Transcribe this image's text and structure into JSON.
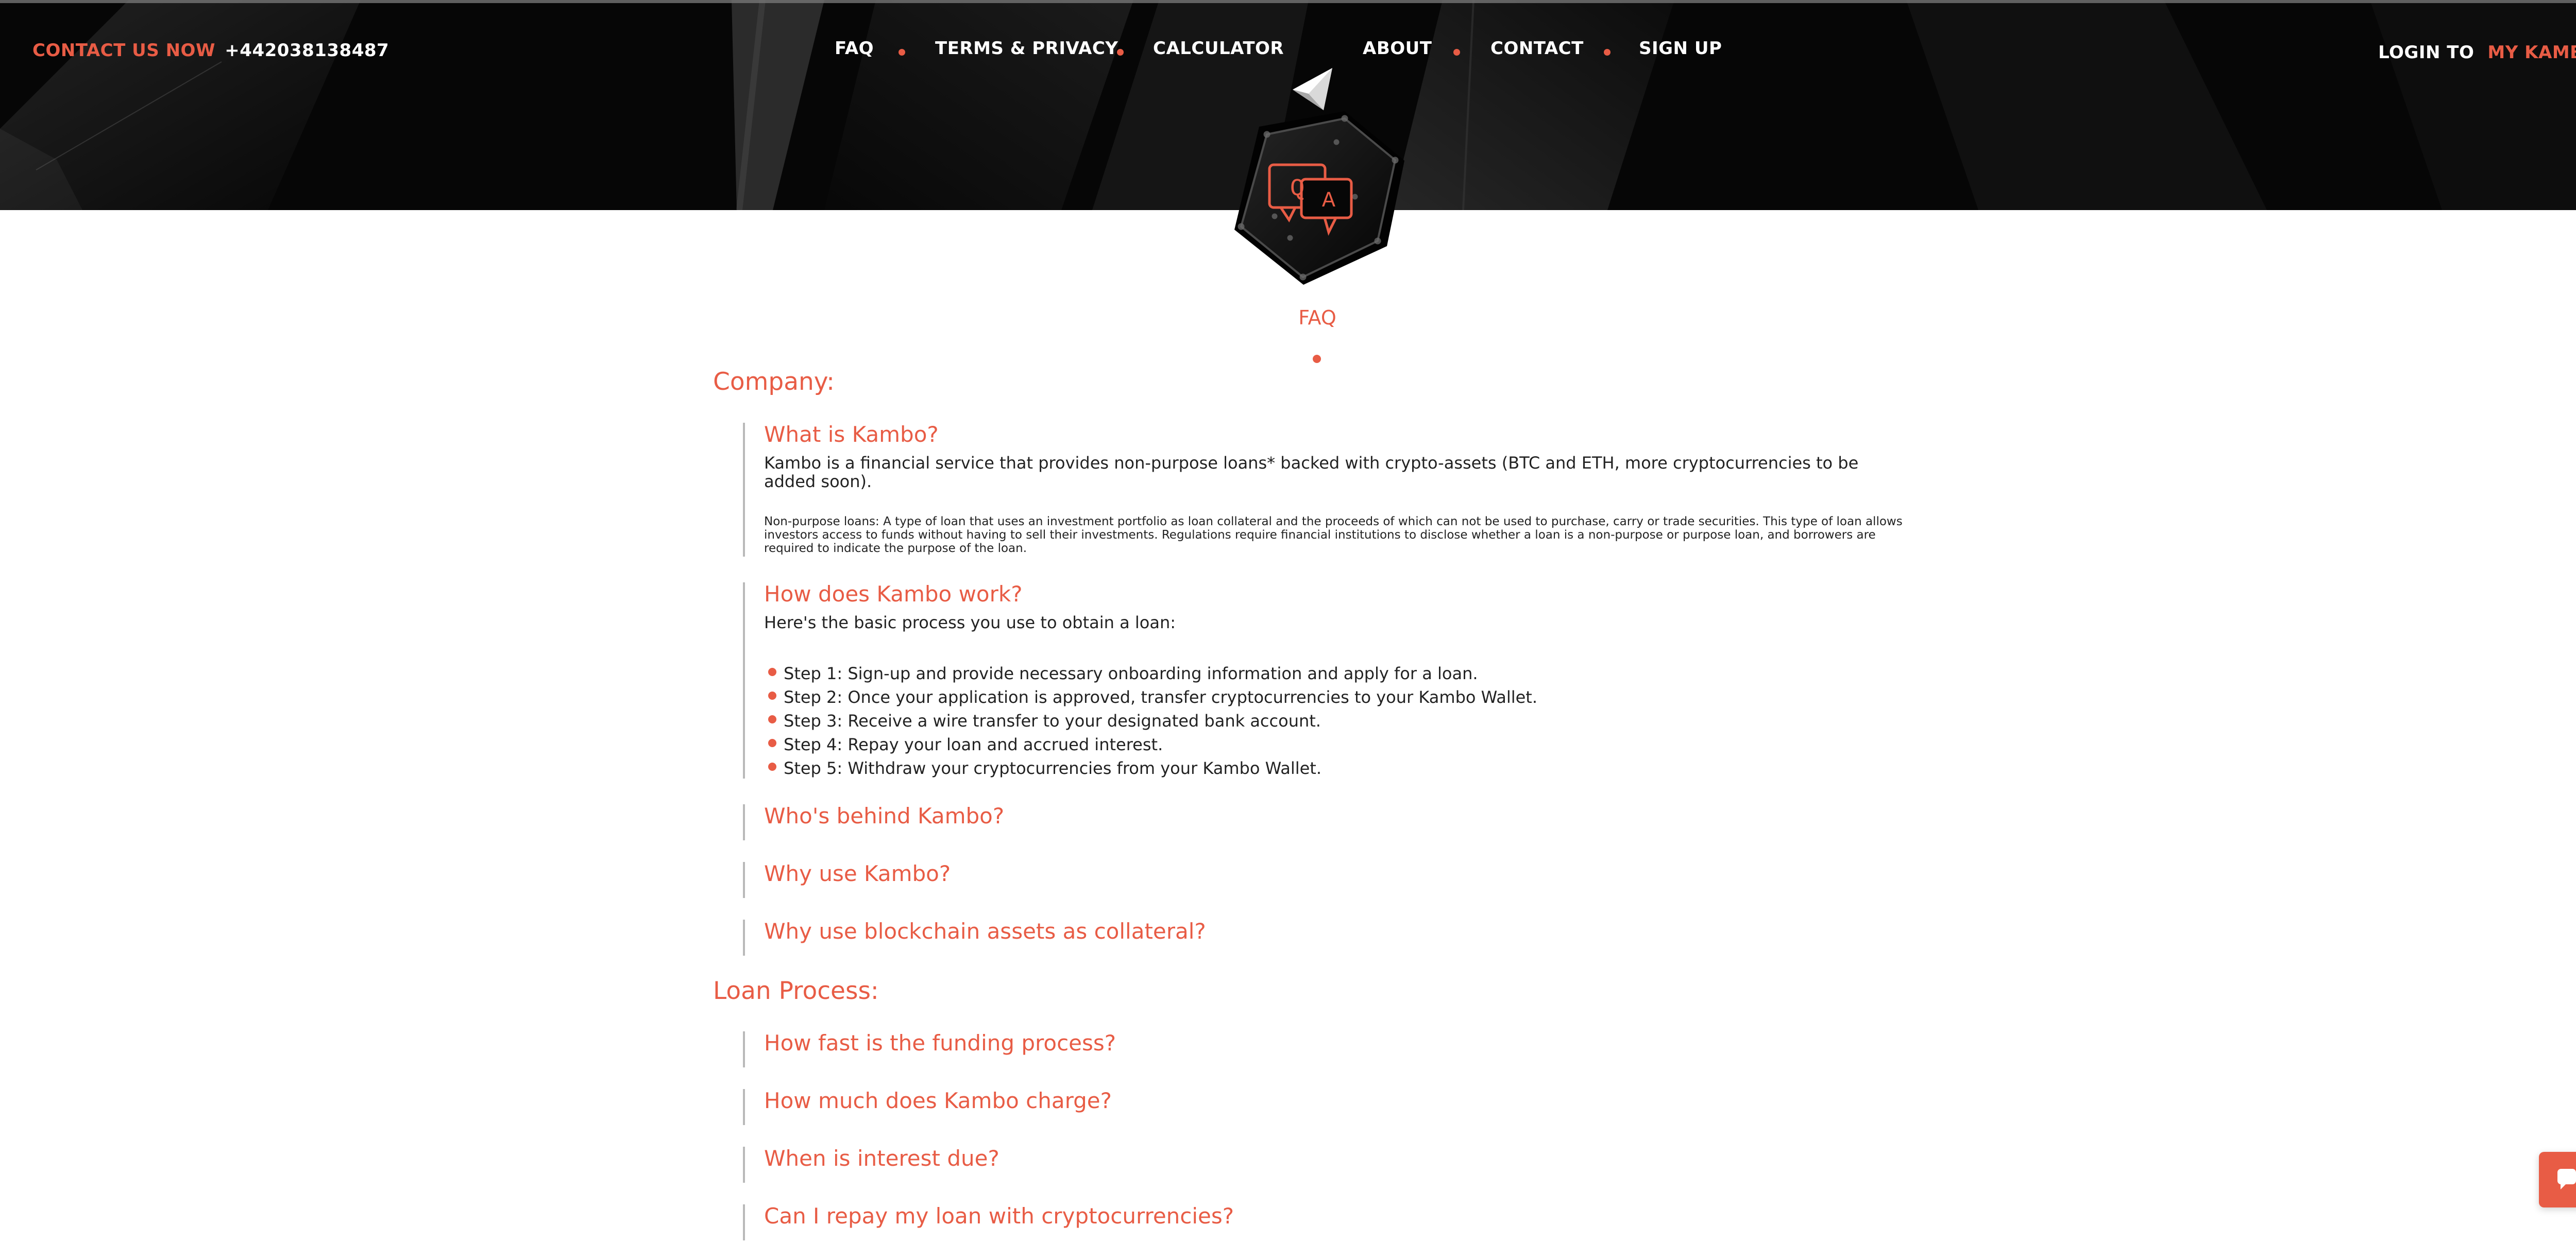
{
  "colors": {
    "accent": "#e85c45",
    "header_bg": "#050505",
    "text_dark": "#222222",
    "text_white": "#ffffff",
    "divider_gray": "#b9b9b9"
  },
  "header": {
    "contact_lead": "CONTACT US NOW",
    "phone": "+442038138487",
    "nav": [
      {
        "label": "FAQ"
      },
      {
        "label": "TERMS & PRIVACY"
      },
      {
        "label": "CALCULATOR"
      },
      {
        "label": "ABOUT"
      },
      {
        "label": "CONTACT"
      },
      {
        "label": "SIGN UP"
      }
    ],
    "login_prefix": "LOGIN TO",
    "login_link": "MY KAMBO",
    "logo_icon": "triangle-logo-icon"
  },
  "badge": {
    "icon": "qa-icon",
    "q_letter": "Q",
    "a_letter": "A"
  },
  "page": {
    "title": "FAQ"
  },
  "sections": [
    {
      "title": "Company:",
      "items": [
        {
          "question": "What is Kambo?",
          "answer": "Kambo is a financial service that provides non-purpose loans* backed with crypto-assets (BTC and ETH, more cryptocurrencies to be added soon).",
          "small_note": "Non-purpose loans: A type of loan that uses an investment portfolio as loan collateral and the proceeds of which can not be used to purchase, carry or trade securities. This type of loan allows investors access to funds without having to sell their investments. Regulations require financial institutions to disclose whether a loan is a non-purpose or purpose loan, and borrowers are required to indicate the purpose of the loan."
        },
        {
          "question": "How does Kambo work?",
          "intro": "Here's the basic process you use to obtain a loan:",
          "steps": [
            "Step 1: Sign-up and provide necessary onboarding information and apply for a loan.",
            "Step 2: Once your application is approved, transfer cryptocurrencies to your Kambo Wallet.",
            "Step 3: Receive a wire transfer to your designated bank account.",
            "Step 4: Repay your loan and accrued interest.",
            "Step 5: Withdraw your cryptocurrencies from your Kambo Wallet."
          ]
        },
        {
          "question": "Who's behind Kambo?"
        },
        {
          "question": "Why use Kambo?"
        },
        {
          "question": "Why use blockchain assets as collateral?"
        }
      ]
    },
    {
      "title": "Loan Process:",
      "items": [
        {
          "question": "How fast is the funding process?"
        },
        {
          "question": "How much does Kambo charge?"
        },
        {
          "question": "When is interest due?"
        },
        {
          "question": "Can I repay my loan with cryptocurrencies?"
        }
      ]
    }
  ],
  "chat": {
    "icon": "chat-bubble-icon"
  }
}
